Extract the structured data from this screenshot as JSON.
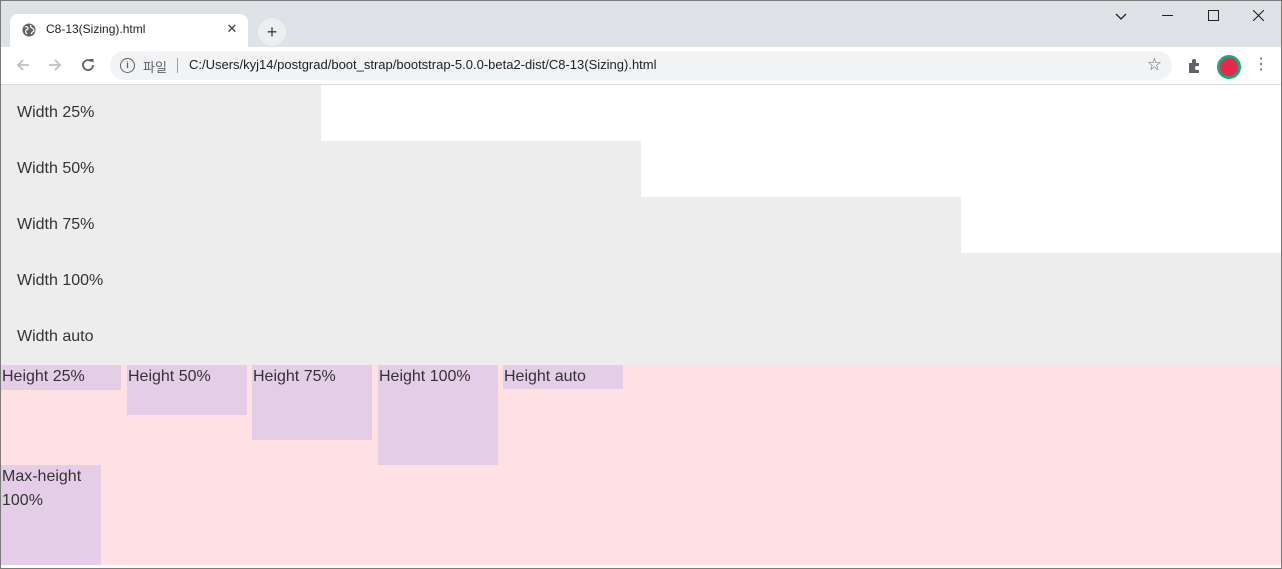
{
  "browser": {
    "tab": {
      "title": "C8-13(Sizing).html"
    },
    "new_tab_icon": "plus-icon",
    "window_controls": {
      "dropdown": "⌵",
      "minimize": "—",
      "maximize": "☐",
      "close": "✕"
    },
    "toolbar": {
      "back": "←",
      "forward": "→",
      "reload": "↻",
      "scheme_label": "파일",
      "url": "C:/Users/kyj14/postgrad/boot_strap/bootstrap-5.0.0-beta2-dist/C8-13(Sizing).html",
      "star": "☆",
      "menu": "⋮"
    }
  },
  "content": {
    "width_bars": [
      {
        "label": "Width 25%",
        "width_percent": 25
      },
      {
        "label": "Width 50%",
        "width_percent": 50
      },
      {
        "label": "Width 75%",
        "width_percent": 75
      },
      {
        "label": "Width 100%",
        "width_percent": 100
      },
      {
        "label": "Width auto",
        "width_percent": 100
      }
    ],
    "height_boxes": [
      {
        "label": "Height 25%",
        "height_percent": 25
      },
      {
        "label": "Height 50%",
        "height_percent": 50
      },
      {
        "label": "Height 75%",
        "height_percent": 75
      },
      {
        "label": "Height 100%",
        "height_percent": 100
      },
      {
        "label": "Height auto",
        "height_percent": null
      }
    ],
    "max_height_box": {
      "line1": "Max-height",
      "line2": "100%"
    },
    "colors": {
      "width_bg": "#ededed",
      "height_area_bg": "#ffe1e3",
      "box_bg": "#e4cee7"
    }
  }
}
